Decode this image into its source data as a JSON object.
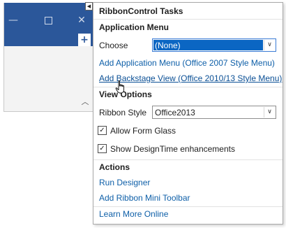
{
  "form": {
    "minimize_glyph": "—",
    "close_glyph": "✕",
    "add_glyph": "+",
    "collapse_glyph": "︿",
    "smart_tag_glyph": "◀"
  },
  "panel": {
    "title": "RibbonControl Tasks",
    "application_menu": {
      "heading": "Application Menu",
      "choose_label": "Choose",
      "choose_value": "(None)",
      "link_add_app_menu": "Add Application Menu (Office 2007 Style Menu)",
      "link_add_backstage": "Add Backstage View (Office 2010/13 Style Menu)"
    },
    "view_options": {
      "heading": "View Options",
      "ribbon_style_label": "Ribbon Style",
      "ribbon_style_value": "Office2013",
      "allow_form_glass": {
        "label": "Allow Form Glass",
        "checked": true
      },
      "show_designtime": {
        "label": "Show DesignTime enhancements",
        "checked": true
      }
    },
    "actions": {
      "heading": "Actions",
      "run_designer": "Run Designer",
      "add_mini_toolbar": "Add Ribbon Mini Toolbar",
      "learn_more": "Learn More Online"
    },
    "check_glyph": "✓",
    "dropdown_glyph": "∨"
  },
  "colors": {
    "ribbon_blue": "#2b579a",
    "link": "#0e5fa8",
    "selection": "#0b66c3"
  }
}
